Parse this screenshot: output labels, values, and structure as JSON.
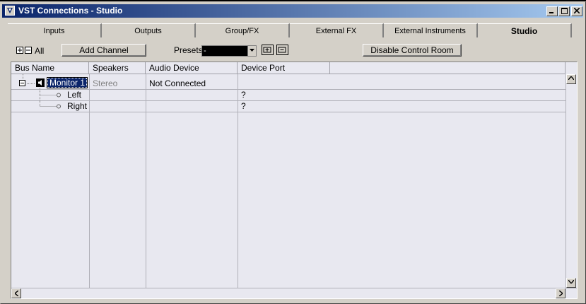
{
  "window": {
    "title": "VST Connections - Studio",
    "icon": "vst-connections-icon",
    "controls": {
      "minimize": "minimize-icon",
      "maximize": "maximize-icon",
      "close": "close-icon"
    }
  },
  "tabs": [
    {
      "label": "Inputs",
      "active": false
    },
    {
      "label": "Outputs",
      "active": false
    },
    {
      "label": "Group/FX",
      "active": false
    },
    {
      "label": "External FX",
      "active": false
    },
    {
      "label": "External Instruments",
      "active": false
    },
    {
      "label": "Studio",
      "active": true
    }
  ],
  "toolbar": {
    "all_label": "All",
    "add_channel_label": "Add Channel",
    "presets_label": "Presets",
    "presets_value": "-",
    "disable_control_room_label": "Disable Control Room"
  },
  "table": {
    "columns": [
      "Bus Name",
      "Speakers",
      "Audio Device",
      "Device Port"
    ],
    "bus": {
      "name": "Monitor 1",
      "speakers": "Stereo",
      "audio_device": "Not Connected",
      "device_port": ""
    },
    "channels": [
      {
        "name": "Left",
        "speakers": "",
        "audio_device": "",
        "device_port": "?"
      },
      {
        "name": "Right",
        "speakers": "",
        "audio_device": "",
        "device_port": "?"
      }
    ]
  },
  "colors": {
    "titlebar_start": "#0a246a",
    "titlebar_end": "#a6caf0",
    "face": "#d4d0c8",
    "grid_bg": "#e8e8f0",
    "selection": "#0a246a"
  }
}
